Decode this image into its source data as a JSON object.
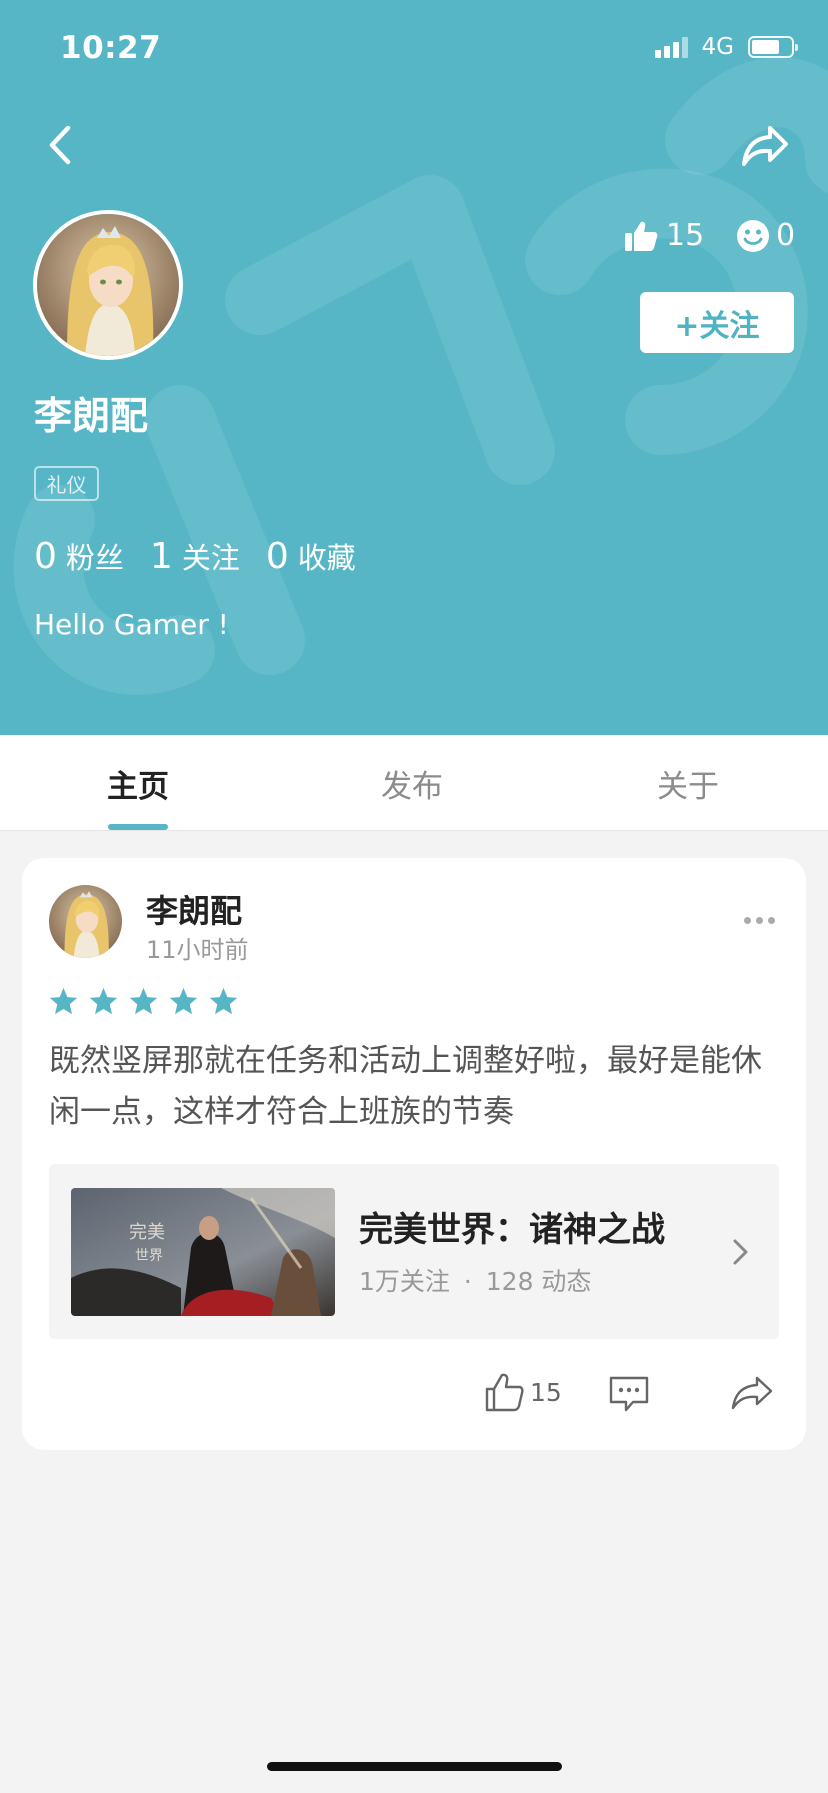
{
  "status_bar": {
    "time": "10:27",
    "network": "4G"
  },
  "colors": {
    "accent": "#56b6c6",
    "header_bg": "#56b6c6",
    "page_bg": "#f3f3f3"
  },
  "profile": {
    "name": "李朗配",
    "role_tag": "礼仪",
    "stats": [
      {
        "num": "0",
        "label": "粉丝"
      },
      {
        "num": "1",
        "label": "关注"
      },
      {
        "num": "0",
        "label": "收藏"
      }
    ],
    "bio": "Hello Gamer !",
    "likes": "15",
    "reactions": "0",
    "follow_label": "+关注"
  },
  "tabs": [
    {
      "label": "主页",
      "active": true
    },
    {
      "label": "发布",
      "active": false
    },
    {
      "label": "关于",
      "active": false
    }
  ],
  "post": {
    "author": "李朗配",
    "time_ago": "11小时前",
    "rating": 5,
    "content": "既然竖屏那就在任务和活动上调整好啦，最好是能休闲一点，这样才符合上班族的节奏",
    "game": {
      "title": "完美世界：诸神之战",
      "followers": "1万关注",
      "separator": "·",
      "posts": "128 动态"
    },
    "like_count": "15"
  },
  "icons": {
    "back": "chevron-left-icon",
    "share": "share-arrow-icon",
    "like": "thumbs-up-icon",
    "smile": "smile-icon",
    "more": "more-dots-icon",
    "star": "star-icon",
    "comment": "comment-icon",
    "chevron": "chevron-right-icon"
  }
}
